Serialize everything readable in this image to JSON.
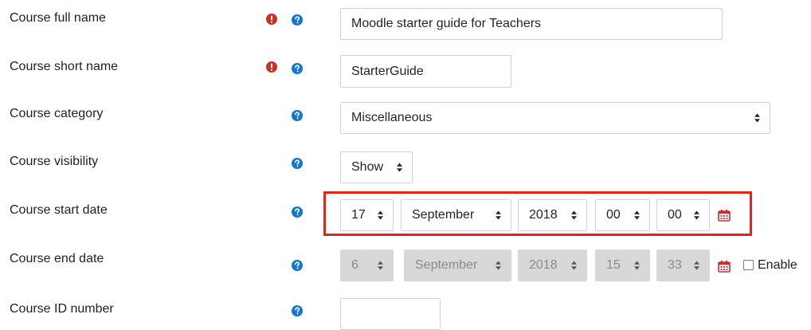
{
  "form": {
    "fullname": {
      "label": "Course full name",
      "value": "Moodle starter guide for Teachers"
    },
    "shortname": {
      "label": "Course short name",
      "value": "StarterGuide"
    },
    "category": {
      "label": "Course category",
      "value": "Miscellaneous"
    },
    "visibility": {
      "label": "Course visibility",
      "value": "Show"
    },
    "startdate": {
      "label": "Course start date",
      "day": "17",
      "month": "September",
      "year": "2018",
      "hour": "00",
      "minute": "00"
    },
    "enddate": {
      "label": "Course end date",
      "day": "6",
      "month": "September",
      "year": "2018",
      "hour": "15",
      "minute": "33",
      "enable_label": "Enable",
      "enabled": false
    },
    "idnumber": {
      "label": "Course ID number",
      "value": ""
    }
  },
  "colors": {
    "required_icon": "#ca3120",
    "help_icon": "#1177d1",
    "highlight_border": "#e0251b",
    "calendar_icon": "#c9302c",
    "disabled_bg": "#d8d8d8"
  },
  "icons": {
    "required": "exclamation-circle-icon",
    "help": "question-circle-icon",
    "calendar": "calendar-icon",
    "select_caret": "sort-caret-icon"
  }
}
